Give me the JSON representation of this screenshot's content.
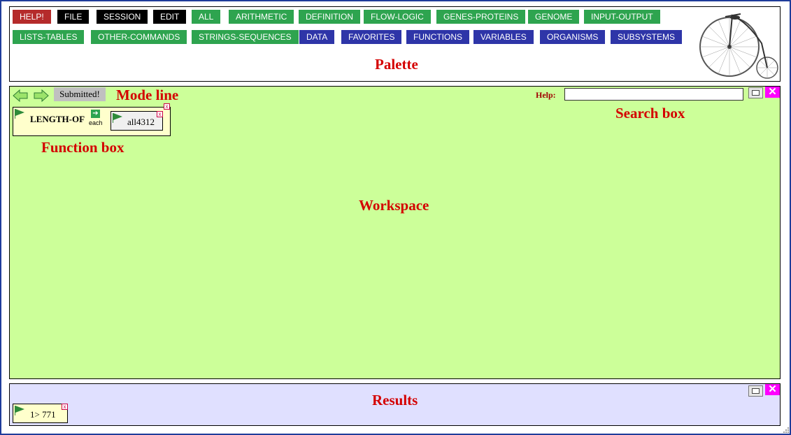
{
  "palette": {
    "buttons": [
      {
        "label": "HELP!",
        "color": "#b52b2b"
      },
      {
        "label": "FILE",
        "color": "#000000"
      },
      {
        "label": "SESSION",
        "color": "#000000"
      },
      {
        "label": "EDIT",
        "color": "#000000"
      },
      {
        "label": "ALL",
        "color": "#2ea44f"
      },
      {
        "label": "ARITHMETIC",
        "color": "#2ea44f"
      },
      {
        "label": "DEFINITION",
        "color": "#2ea44f"
      },
      {
        "label": "FLOW-LOGIC",
        "color": "#2ea44f"
      },
      {
        "label": "GENES-PROTEINS",
        "color": "#2ea44f"
      },
      {
        "label": "GENOME",
        "color": "#2ea44f"
      },
      {
        "label": "INPUT-OUTPUT",
        "color": "#2ea44f"
      },
      {
        "label": "LISTS-TABLES",
        "color": "#2ea44f"
      },
      {
        "label": "OTHER-COMMANDS",
        "color": "#2ea44f"
      },
      {
        "label": "STRINGS-SEQUENCES",
        "color": "#2ea44f"
      },
      {
        "label": "DATA",
        "color": "#2e35a8"
      },
      {
        "label": "FAVORITES",
        "color": "#2e35a8"
      },
      {
        "label": "FUNCTIONS",
        "color": "#2e35a8"
      },
      {
        "label": "VARIABLES",
        "color": "#2e35a8"
      },
      {
        "label": "ORGANISMS",
        "color": "#2e35a8"
      },
      {
        "label": "SUBSYSTEMS",
        "color": "#2e35a8"
      }
    ],
    "note": "Palette",
    "logo_icon": "penny-farthing-bicycle"
  },
  "workspace": {
    "mode_line": "Submitted!",
    "mode_line_note": "Mode line",
    "help_label": "Help:",
    "help_value": "",
    "search_note": "Search box",
    "function_box": {
      "name": "LENGTH-OF",
      "each_label": "each",
      "argument": "all4312"
    },
    "function_note": "Function box",
    "note": "Workspace",
    "background": "#ccff99"
  },
  "results": {
    "note": "Results",
    "entry": "1>  771",
    "background": "#e0e0ff"
  },
  "colors": {
    "annotation": "#d40000",
    "close": "#ff00ff"
  }
}
